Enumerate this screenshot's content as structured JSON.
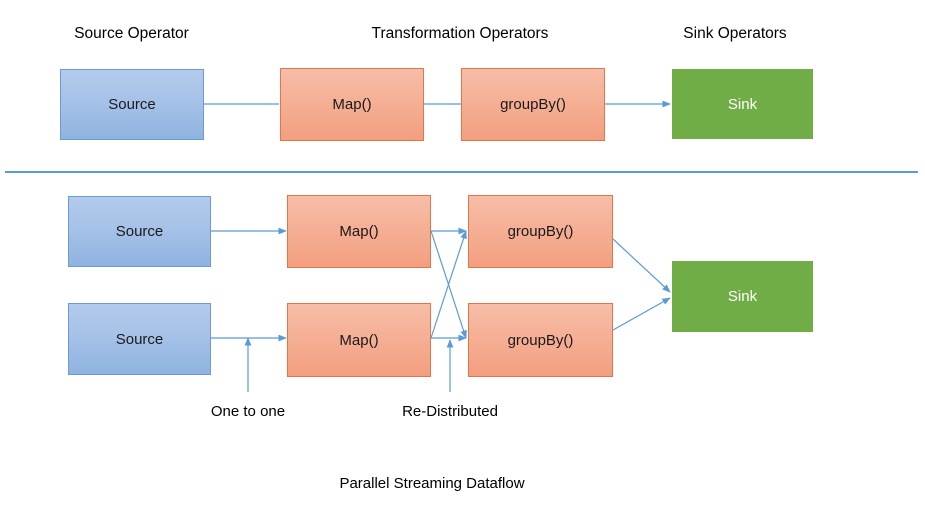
{
  "diagram": {
    "caption": "Parallel Streaming Dataflow",
    "colors": {
      "source_fill": "#a6c2e8",
      "transform_fill": "#f5b096",
      "sink_fill": "#70ad47",
      "edge_stroke": "#5b9bd5",
      "text": "#1a1a1a"
    }
  },
  "headers": {
    "source": "Source Operator",
    "transformation": "Transformation Operators",
    "sink": "Sink Operators"
  },
  "top_row": {
    "nodes": [
      {
        "label": "Source",
        "type": "source"
      },
      {
        "label": "Map()",
        "type": "transform"
      },
      {
        "label": "groupBy()",
        "type": "transform"
      },
      {
        "label": "Sink",
        "type": "sink"
      }
    ]
  },
  "bottom_rows": {
    "lane1": [
      {
        "label": "Source",
        "type": "source"
      },
      {
        "label": "Map()",
        "type": "transform"
      },
      {
        "label": "groupBy()",
        "type": "transform"
      }
    ],
    "lane2": [
      {
        "label": "Source",
        "type": "source"
      },
      {
        "label": "Map()",
        "type": "transform"
      },
      {
        "label": "groupBy()",
        "type": "transform"
      }
    ],
    "sink": {
      "label": "Sink",
      "type": "sink"
    }
  },
  "annotations": {
    "one_to_one": "One to one",
    "redistributed": "Re-Distributed"
  }
}
